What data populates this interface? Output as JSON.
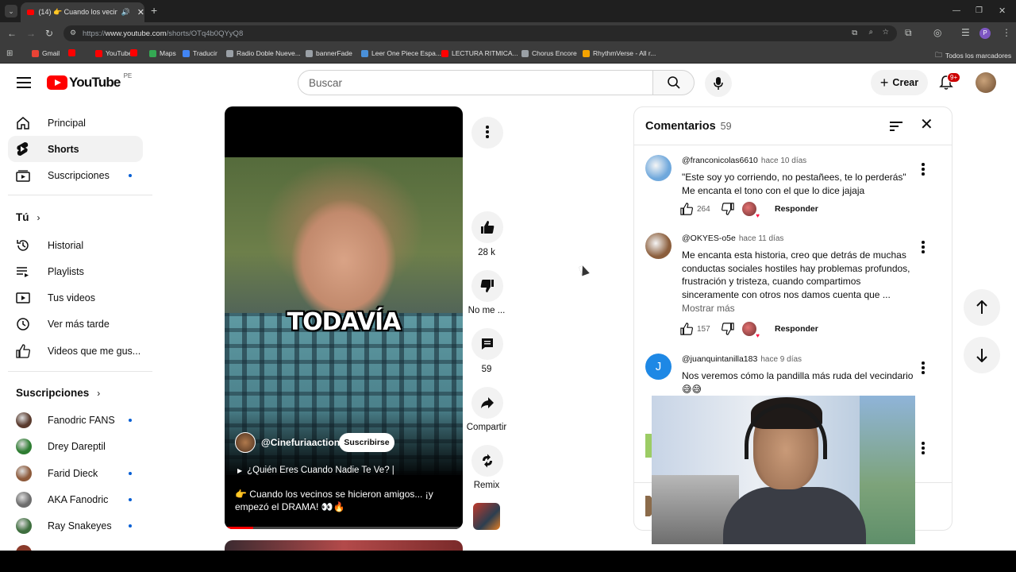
{
  "browser": {
    "tab_title": "(14) 👉 Cuando los vecinos...",
    "url_prefix": "https://",
    "url_domain": "www.youtube.com",
    "url_path": "/shorts/OTq4b0QYyQ8",
    "bookmarks": [
      {
        "label": "Gmail",
        "color": "#ea4335"
      },
      {
        "label": "",
        "color": "#ff0000"
      },
      {
        "label": "YouTube",
        "color": "#ff0000"
      },
      {
        "label": "",
        "color": "#ff0000"
      },
      {
        "label": "Maps",
        "color": "#34a853"
      },
      {
        "label": "Traducir",
        "color": "#4285f4"
      },
      {
        "label": "Radio Doble Nueve...",
        "color": "#9aa0a6"
      },
      {
        "label": "bannerFade",
        "color": "#9aa0a6"
      },
      {
        "label": "Leer One Piece Espa...",
        "color": "#4a90d9"
      },
      {
        "label": "LECTURA RITMICA...",
        "color": "#ff0000"
      },
      {
        "label": "Chorus Encore",
        "color": "#9aa0a6"
      },
      {
        "label": "RhythmVerse - All r...",
        "color": "#f4a300"
      }
    ],
    "all_bookmarks": "Todos los marcadores",
    "profile_initial": "P"
  },
  "header": {
    "logo_text": "YouTube",
    "country": "PE",
    "search_placeholder": "Buscar",
    "create_label": "Crear",
    "notif_count": "9+"
  },
  "sidebar": {
    "main": [
      {
        "label": "Principal",
        "icon": "home-icon"
      },
      {
        "label": "Shorts",
        "icon": "shorts-icon"
      },
      {
        "label": "Suscripciones",
        "icon": "subscriptions-icon"
      }
    ],
    "you_heading": "Tú",
    "you_items": [
      {
        "label": "Historial",
        "icon": "history-icon"
      },
      {
        "label": "Playlists",
        "icon": "playlists-icon"
      },
      {
        "label": "Tus videos",
        "icon": "your-videos-icon"
      },
      {
        "label": "Ver más tarde",
        "icon": "watch-later-icon"
      },
      {
        "label": "Videos que me gus...",
        "icon": "liked-videos-icon"
      }
    ],
    "subs_heading": "Suscripciones",
    "subs": [
      {
        "label": "Fanodric FANS",
        "color": "#5a3b2e",
        "dot": true
      },
      {
        "label": "Drey Dareptil",
        "color": "#2e7d32",
        "dot": false
      },
      {
        "label": "Farid Dieck",
        "color": "#8d5a3b",
        "dot": true
      },
      {
        "label": "AKA Fanodric",
        "color": "#6d6d6d",
        "dot": true
      },
      {
        "label": "Ray Snakeyes",
        "color": "#3e6e3e",
        "dot": true
      }
    ]
  },
  "short": {
    "caption_overlay": "TODAVÍA",
    "channel": "@Cinefuriaaction",
    "subscribe_label": "Suscribirse",
    "playlist_label": "¿Quién Eres Cuando Nadie Te Ve? |",
    "title": "👉 Cuando los vecinos se hicieron amigos... ¡y empezó el DRAMA! 👀🔥"
  },
  "actions": {
    "likes": "28 k",
    "dislike": "No me ...",
    "comments": "59",
    "share": "Compartir",
    "remix": "Remix"
  },
  "comments_panel": {
    "title": "Comentarios",
    "count": "59",
    "items": [
      {
        "user": "@franconicolas6610",
        "time": "hace 10 días",
        "lines": [
          "\"Este soy yo corriendo, no pestañees, te lo perderás\"",
          "Me encanta el tono con el que lo dice jajaja"
        ],
        "likes": "264",
        "reply": "Responder",
        "avatar_color": "#6fa8dc"
      },
      {
        "user": "@OKYES-o5e",
        "time": "hace 11 días",
        "lines": [
          "Me encanta esta historia, creo que detrás de muchas",
          "conductas sociales hostiles hay problemas profundos,",
          "frustración y tristeza, cuando compartimos",
          "sinceramente con otros nos damos cuenta que ..."
        ],
        "more": "Mostrar más",
        "likes": "157",
        "reply": "Responder",
        "avatar_color": "#8b5e3c"
      },
      {
        "user": "@juanquintanilla183",
        "time": "hace 9 días",
        "lines": [
          "Nos veremos cómo la pandilla más ruda del vecindario",
          "😅😅"
        ],
        "avatar_letter": "J",
        "avatar_color": "#1e88e5"
      }
    ]
  }
}
